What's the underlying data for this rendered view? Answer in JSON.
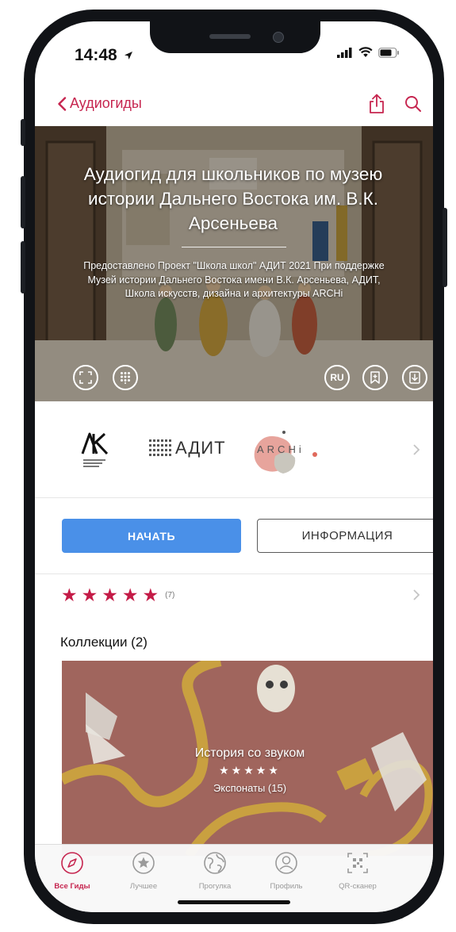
{
  "status_bar": {
    "time": "14:48"
  },
  "nav": {
    "back_label": "Аудиогиды"
  },
  "hero": {
    "title": "Аудиогид для школьников по музею истории Дальнего Востока им. В.К. Арсеньева",
    "subtitle": "Предоставлено Проект \"Школа школ\" АДИТ 2021 При поддержке Музей истории Дальнего Востока имени В.К. Арсеньева, АДИТ, Школа искусств, дизайна и архитектуры ARCHi",
    "language": "RU"
  },
  "partners": {
    "logo_2_text": "АДИТ",
    "logo_3_text": "ARCHi"
  },
  "actions": {
    "start_label": "НАЧАТЬ",
    "info_label": "ИНФОРМАЦИЯ"
  },
  "rating": {
    "stars": 5,
    "count": "(7)"
  },
  "collections": {
    "header": "Коллекции (2)",
    "items": [
      {
        "title": "История со звуком",
        "stars": "★★★★★",
        "subtitle": "Экспонаты (15)"
      }
    ]
  },
  "tabbar": {
    "items": [
      {
        "label": "Все Гиды",
        "icon": "compass-icon",
        "active": true
      },
      {
        "label": "Лучшее",
        "icon": "star-circle-icon"
      },
      {
        "label": "Прогулка",
        "icon": "globe-icon"
      },
      {
        "label": "Профиль",
        "icon": "person-icon"
      },
      {
        "label": "QR-сканер",
        "icon": "qr-icon"
      }
    ]
  },
  "colors": {
    "accent": "#c6254f",
    "star": "#c41b47",
    "primary_button": "#4a90e8",
    "collection_bg": "#a0655d"
  }
}
